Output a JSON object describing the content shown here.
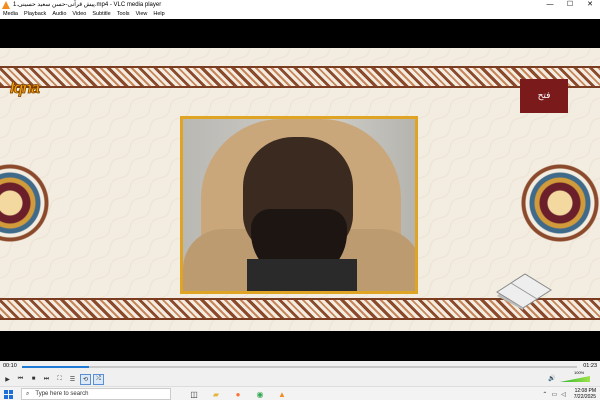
{
  "window": {
    "title": "1.پیش قرآنی-حسن سعید حسینی.mp4 - VLC media player",
    "minimize": "—",
    "maximize": "☐",
    "close": "✕"
  },
  "menu": [
    "Media",
    "Playback",
    "Audio",
    "Video",
    "Subtitle",
    "Tools",
    "View",
    "Help"
  ],
  "video": {
    "logo_left": "Iqna",
    "logo_right": "فتح"
  },
  "playback": {
    "current_time": "00:10",
    "total_time": "01:23",
    "progress": 0.12,
    "volume_label": "100%"
  },
  "controls": {
    "play": "▶",
    "prev": "⏮",
    "stop": "■",
    "next": "⏭",
    "fullscreen": "⛶",
    "playlist": "☰",
    "loop": "⟲",
    "random": "⤮",
    "volume_icon": "🔊"
  },
  "taskbar": {
    "search_placeholder": "Type here to search",
    "time": "12:08 PM",
    "date": "7/22/2025"
  },
  "colors": {
    "accent_blue": "#1e7ad4",
    "frame_gold": "#e0a425",
    "vlc_orange": "#f28c1e"
  }
}
